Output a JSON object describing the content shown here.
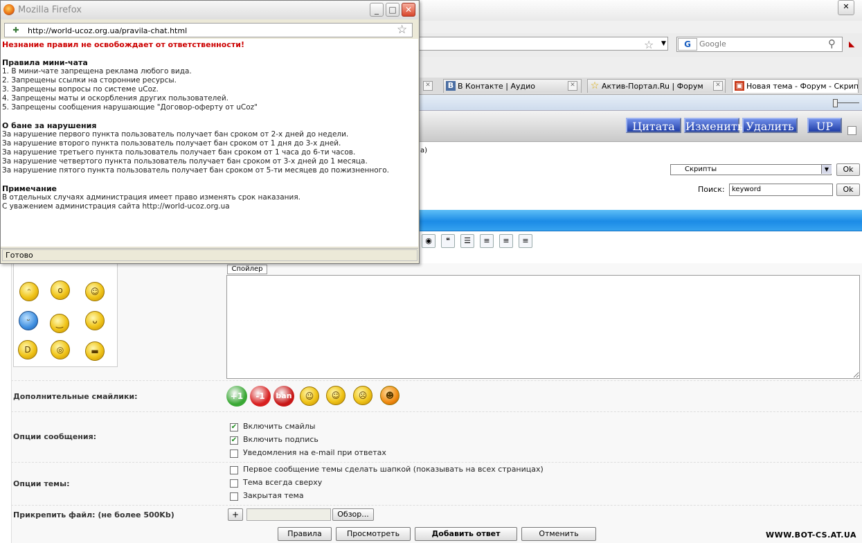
{
  "background": {
    "search_placeholder": "Google",
    "tabs": [
      {
        "label": "В Контакте | Аудио",
        "icon": "B"
      },
      {
        "label": "Актив-Портал.Ru | Форум",
        "icon": "☆"
      },
      {
        "label": "Новая тема - Форум - Скрипт...",
        "icon": "▣"
      }
    ],
    "post_buttons": {
      "quote": "Цитата",
      "edit": "Изменить",
      "delete": "Удалить",
      "up": "UP"
    },
    "cut_text": "a)",
    "category_select": "Скрипты",
    "ok": "Ok",
    "search_label": "Поиск:",
    "search_value": "keyword",
    "spoiler": "Спойлер",
    "extra_smileys_label": "Дополнительные смайлики:",
    "badges": [
      {
        "text": "+1",
        "color": "#3aa835"
      },
      {
        "text": "-1",
        "color": "#d82020"
      },
      {
        "text": "ban",
        "color": "#c81818"
      }
    ],
    "message_options_label": "Опции сообщения:",
    "message_options": [
      {
        "label": "Включить смайлы",
        "checked": true
      },
      {
        "label": "Включить подпись",
        "checked": true
      },
      {
        "label": "Уведомления на e-mail при ответах",
        "checked": false
      }
    ],
    "topic_options_label": "Опции темы:",
    "topic_options": [
      {
        "label": "Первое сообщение темы сделать шапкой (показывать на всех страницах)",
        "checked": false
      },
      {
        "label": "Тема всегда сверху",
        "checked": false
      },
      {
        "label": "Закрытая тема",
        "checked": false
      }
    ],
    "attach_label": "Прикрепить файл: (не более 500Kb)",
    "attach_plus": "+",
    "browse": "Обзор...",
    "buttons": {
      "rules": "Правила",
      "preview": "Просмотреть",
      "add_reply": "Добавить ответ",
      "cancel": "Отменить"
    },
    "watermark": "WWW.BOT-CS.AT.UA"
  },
  "popup": {
    "title": "Mozilla Firefox",
    "url": "http://world-ucoz.org.ua/pravila-chat.html",
    "status": "Готово",
    "warning": "Незнание правил не освобождает от ответственности!",
    "rules_heading": "Правила мини-чата",
    "rules": [
      "1. В мини-чате запрещена реклама любого вида.",
      "2. Запрещены ссылки на сторонние ресурсы.",
      "3. Запрещены вопросы по системе uCoz.",
      "4. Запрещены маты и оскорбления других пользователей.",
      "5. Запрещены сообщения нарушающие \"Договор-оферту от uCoz\""
    ],
    "ban_heading": "О бане за нарушения",
    "bans": [
      "За нарушение первого пункта пользователь получает бан сроком от 2-х дней до недели.",
      "За нарушение второго пункта пользователь получает бан сроком от 1 дня до 3-х дней.",
      "За нарушение третьего пункта пользователь получает бан сроком от 1 часа до 6-ти часов.",
      "За нарушение четвертого пункта пользователь получает бан сроком от 3-х дней до 1 месяца.",
      "За нарушение пятого пункта пользователь получает бан сроком от 5-ти месяцев до пожизненного."
    ],
    "note_heading": "Примечание",
    "notes": [
      "В отдельных случаях администрация имеет право изменять срок наказания.",
      "С уважением администрация сайта http://world-ucoz.org.ua"
    ]
  }
}
